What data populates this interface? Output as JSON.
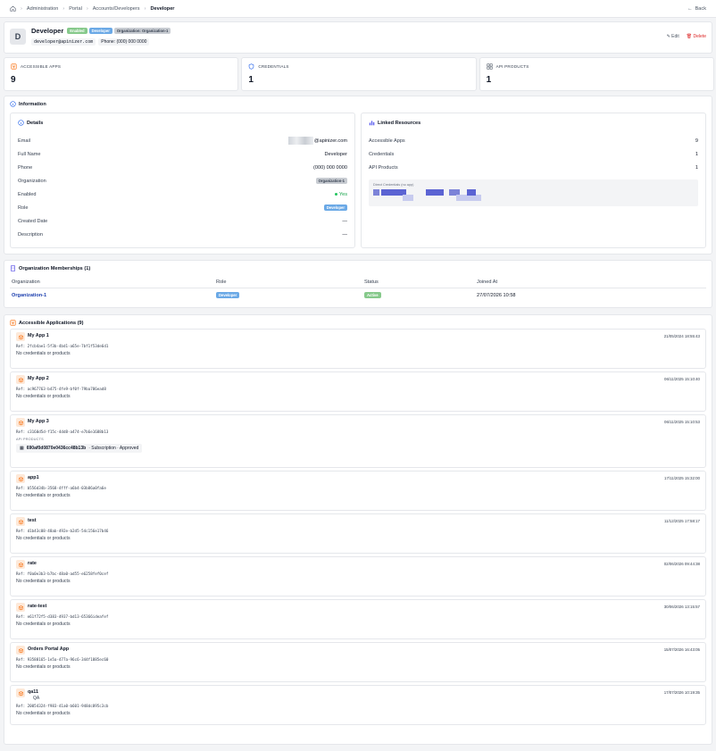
{
  "breadcrumb": {
    "items": [
      "Administration",
      "Portal",
      "Accounts/Developers"
    ],
    "current": "Developer",
    "back": "Back"
  },
  "developer": {
    "initial": "D",
    "name": "Developer",
    "badges": [
      "Enabled",
      "Developer",
      "Organization: Organization-1"
    ],
    "email": "developer@apinizer.com",
    "phone": "Phone: (000) 000 0000",
    "edit": "Edit",
    "delete": "Delete"
  },
  "stats": [
    {
      "label": "ACCESSIBLE APPS",
      "value": "9",
      "icon": "box-icon",
      "color": "#f97316"
    },
    {
      "label": "CREDENTIALS",
      "value": "1",
      "icon": "shield-icon",
      "color": "#2563eb"
    },
    {
      "label": "API PRODUCTS",
      "value": "1",
      "icon": "grid-icon",
      "color": "#4b5563"
    }
  ],
  "information": {
    "title": "Information",
    "details_title": "Details",
    "details": [
      {
        "label": "Email",
        "value": "@apinizer.com"
      },
      {
        "label": "Full Name",
        "value": "Developer"
      },
      {
        "label": "Phone",
        "value": "(000) 000 0000"
      },
      {
        "label": "Organization",
        "value": "Organization-1"
      },
      {
        "label": "Enabled",
        "value": "Yes"
      },
      {
        "label": "Role",
        "value": "Developer"
      },
      {
        "label": "Created Date",
        "value": "—"
      },
      {
        "label": "Description",
        "value": "—"
      }
    ],
    "linked_title": "Linked Resources",
    "linked": [
      {
        "label": "Accessible Apps",
        "value": "9"
      },
      {
        "label": "Credentials",
        "value": "1"
      },
      {
        "label": "API Products",
        "value": "1"
      }
    ],
    "direct_credentials": "Direct Credentials (no app)"
  },
  "memberships": {
    "title": "Organization Memberships (1)",
    "columns": [
      "Organization",
      "Role",
      "Status",
      "Joined At"
    ],
    "rows": [
      {
        "organization": "Organization-1",
        "role": "Developer",
        "status": "Active",
        "joined": "27/07/2026 10:58"
      }
    ]
  },
  "applications": {
    "title": "Accessible Applications (9)",
    "no_credentials": "No credentials or products",
    "api_products_label": "API PRODUCTS",
    "items": [
      {
        "name": "My App 1",
        "date": "21/05/2024 18:55:43",
        "ref": "Ref: 2fcb4ae1-5f3b-4bd1-a65e-7bf1f53de6d1"
      },
      {
        "name": "My App 2",
        "date": "06/11/2025 15:10:40",
        "ref": "Ref: ac967763-b475-4fe9-bf0f-79ba786ead8"
      },
      {
        "name": "My App 3",
        "date": "06/11/2025 15:10:53",
        "ref": "Ref: c3160d5d-f15c-4dd8-a474-e7b6e1688b13",
        "product": "690af0d0870e0436cc48b13b",
        "product_meta": "· Subscription · Approved"
      },
      {
        "name": "app1",
        "date": "17/11/2025 15:32:00",
        "ref": "Ref: b556d34b-3568-4fff-a6b4-03b86a0fa6e"
      },
      {
        "name": "test",
        "date": "11/12/2025 17:58:17",
        "ref": "Ref: d1b43c08-48ab-492e-b2d5-54c156e17b46"
      },
      {
        "name": "rate",
        "date": "02/06/2026 09:44:38",
        "ref": "Ref: f0a0e3b3-b7bc-48a0-ad55-e6258fef0cef"
      },
      {
        "name": "rate-test",
        "date": "30/06/2026 13:15:57",
        "ref": "Ref: e61f72f5-d383-4937-bd13-65366ideafef"
      },
      {
        "name": "Orders Portal App",
        "date": "15/07/2026 16:43:05",
        "ref": "Ref: 93588165-1e5a-477a-96c6-344f1885ec60"
      },
      {
        "name": "qa11",
        "desc": "QA",
        "date": "17/07/2026 10:19:35",
        "ref": "Ref: 20054324-f983-41a0-b601-948dc895c3cb"
      }
    ]
  }
}
